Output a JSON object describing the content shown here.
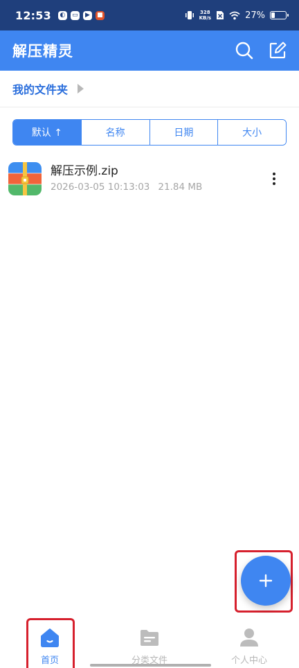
{
  "status_bar": {
    "time": "12:53",
    "speed_value": "328",
    "speed_unit": "KB/s",
    "battery": "27%",
    "battery_level": 0.27
  },
  "app_bar": {
    "title": "解压精灵",
    "search_icon": "search-icon",
    "edit_icon": "edit-icon"
  },
  "breadcrumb": {
    "items": [
      "我的文件夹"
    ]
  },
  "sort_tabs": [
    {
      "label": "默认 ↑",
      "active": true
    },
    {
      "label": "名称",
      "active": false
    },
    {
      "label": "日期",
      "active": false
    },
    {
      "label": "大小",
      "active": false
    }
  ],
  "files": [
    {
      "name": "解压示例.zip",
      "date": "2026-03-05 10:13:03",
      "size": "21.84 MB",
      "icon": "zip-archive-icon"
    }
  ],
  "fab": {
    "icon": "plus-icon"
  },
  "bottom_nav": [
    {
      "label": "首页",
      "icon": "home-icon",
      "active": true
    },
    {
      "label": "分类文件",
      "icon": "folder-icon",
      "active": false
    },
    {
      "label": "个人中心",
      "icon": "person-icon",
      "active": false
    }
  ],
  "colors": {
    "primary": "#3f86f1",
    "status_bar": "#1f3f7c",
    "highlight": "#d6202d"
  }
}
